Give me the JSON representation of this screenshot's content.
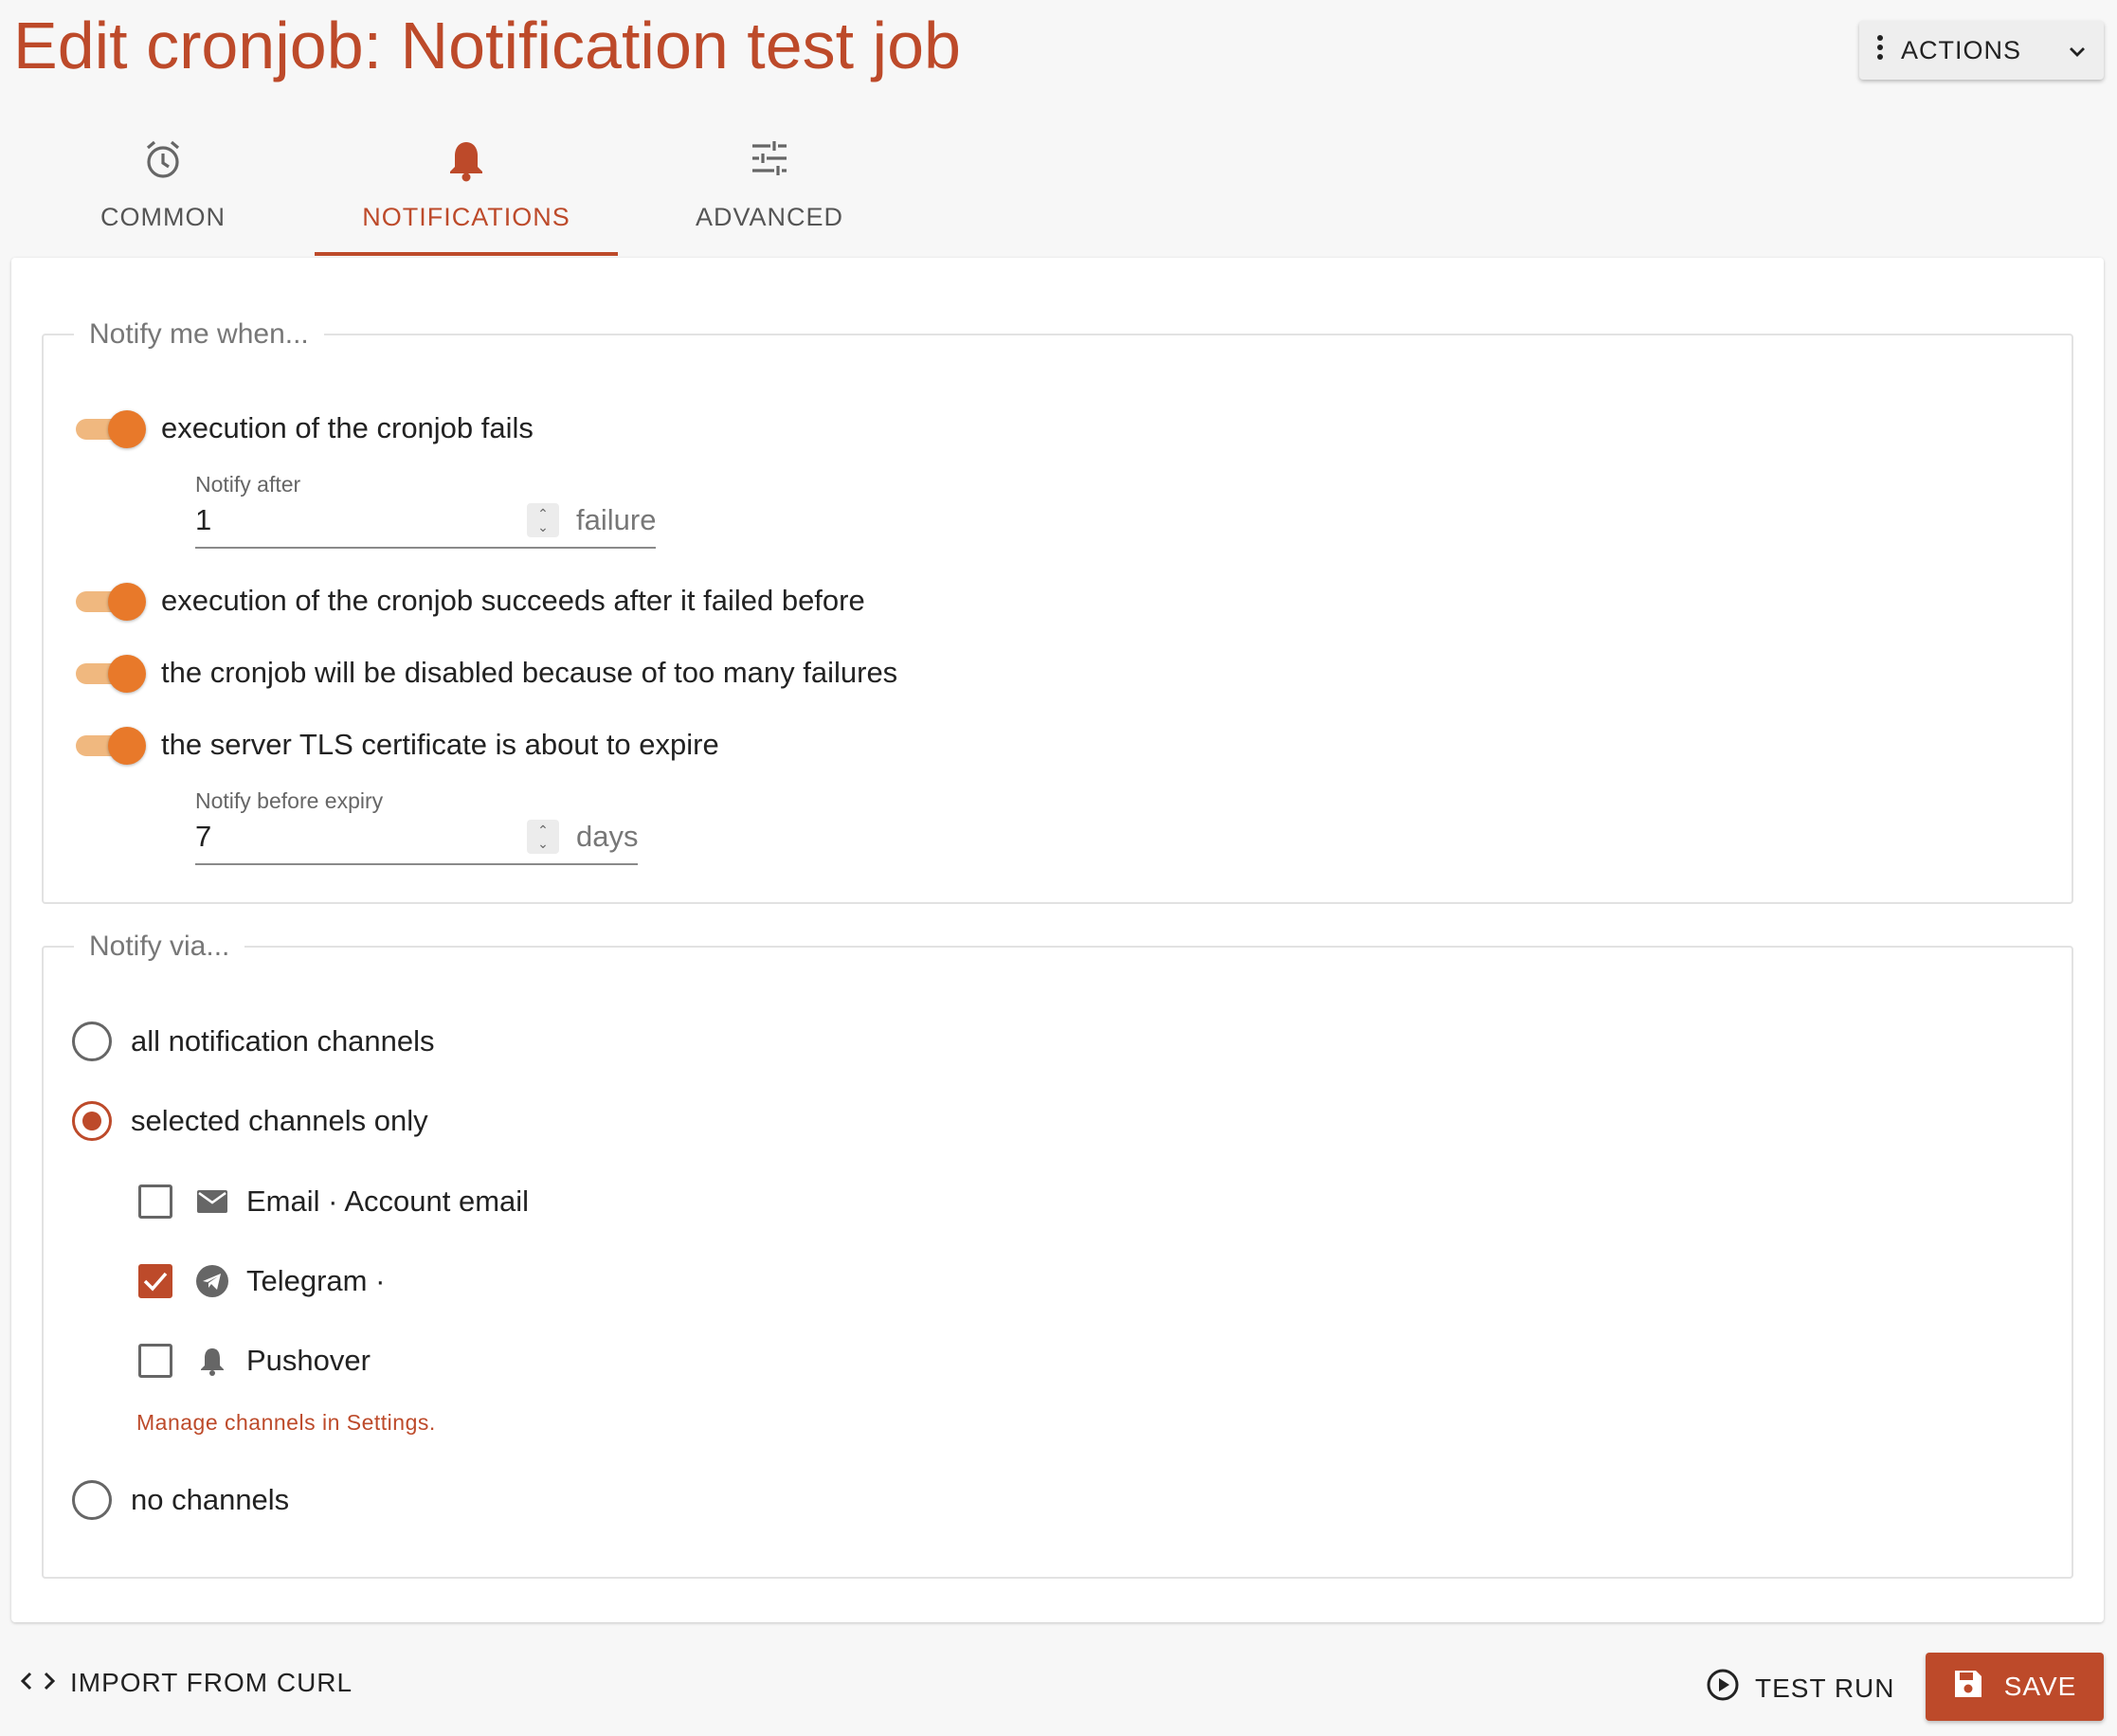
{
  "page": {
    "title": "Edit cronjob: Notification test job"
  },
  "header": {
    "actions_label": "ACTIONS",
    "actions_icon": "more-vert-icon",
    "dropdown_icon": "chevron-down-icon"
  },
  "tabs": [
    {
      "label": "COMMON",
      "icon": "alarm-clock-icon",
      "active": false
    },
    {
      "label": "NOTIFICATIONS",
      "icon": "bell-icon",
      "active": true
    },
    {
      "label": "ADVANCED",
      "icon": "tune-sliders-icon",
      "active": false
    }
  ],
  "notify_when": {
    "legend": "Notify me when...",
    "toggles": [
      {
        "label": "execution of the cronjob fails",
        "on": true
      },
      {
        "label": "execution of the cronjob succeeds after it failed before",
        "on": true
      },
      {
        "label": "the cronjob will be disabled because of too many failures",
        "on": true
      },
      {
        "label": "the server TLS certificate is about to expire",
        "on": true
      }
    ],
    "failure_field": {
      "label": "Notify after",
      "value": "1",
      "suffix": "failure"
    },
    "expiry_field": {
      "label": "Notify before expiry",
      "value": "7",
      "suffix": "days"
    }
  },
  "notify_via": {
    "legend": "Notify via...",
    "options": [
      {
        "label": "all notification channels",
        "checked": false
      },
      {
        "label": "selected channels only",
        "checked": true
      },
      {
        "label": "no channels",
        "checked": false
      }
    ],
    "channels": [
      {
        "label": "Email · Account email",
        "icon": "email-icon",
        "checked": false
      },
      {
        "label": "Telegram ·",
        "icon": "telegram-icon",
        "checked": true
      },
      {
        "label": "Pushover",
        "icon": "bell-icon",
        "checked": false
      }
    ],
    "manage_link": "Manage channels in Settings."
  },
  "footer": {
    "import_label": "IMPORT FROM CURL",
    "test_run_label": "TEST RUN",
    "save_label": "SAVE"
  },
  "colors": {
    "accent": "#bd4a2a",
    "toggle_thumb": "#e8792a",
    "toggle_track": "#f0b87f"
  }
}
